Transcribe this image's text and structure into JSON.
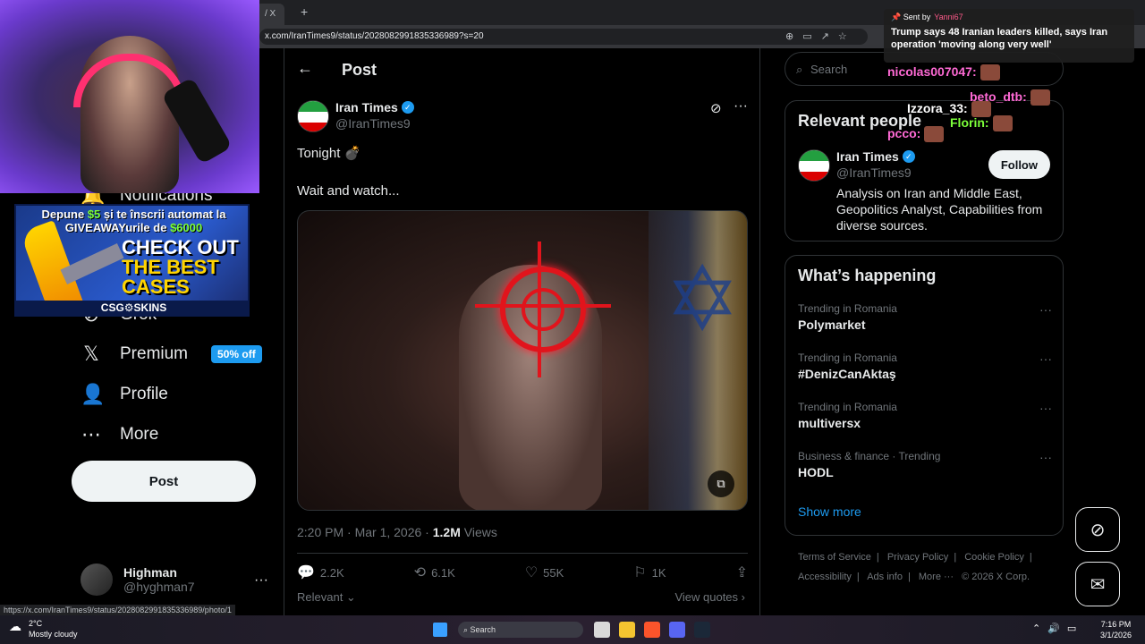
{
  "browser": {
    "tab_title": "/ X",
    "url": "x.com/IranTimes9/status/2028082991835336989?s=20",
    "status_url": "https://x.com/IranTimes9/status/2028082991835336989/photo/1"
  },
  "nav": {
    "notifications": "Notifications",
    "grok": "Grok",
    "premium": "Premium",
    "premium_badge": "50% off",
    "profile": "Profile",
    "more": "More",
    "post_button": "Post",
    "account_name": "Highman",
    "account_handle": "@hyghman7"
  },
  "post": {
    "header": "Post",
    "author_name": "Iran Times",
    "author_handle": "@IranTimes9",
    "line1": "Tonight 💣",
    "line2": "Wait and watch...",
    "timestamp": "2:20 PM · Mar 1, 2026 · ",
    "views_count": "1.2M",
    "views_label": " Views",
    "replies": "2.2K",
    "reposts": "6.1K",
    "likes": "55K",
    "bookmarks": "1K",
    "relevant": "Relevant",
    "view_quotes": "View quotes"
  },
  "right": {
    "search_placeholder": "Search",
    "relevant_people_title": "Relevant people",
    "rp_name": "Iran Times",
    "rp_handle": "@IranTimes9",
    "follow": "Follow",
    "rp_bio": "Analysis on Iran and Middle East, Geopolitics Analyst, Capabilities from diverse sources.",
    "happening_title": "What’s happening",
    "trends": [
      {
        "meta": "Trending in Romania",
        "name": "Polymarket"
      },
      {
        "meta": "Trending in Romania",
        "name": "#DenizCanAktaş"
      },
      {
        "meta": "Trending in Romania",
        "name": "multiversx"
      },
      {
        "meta": "Business & finance · Trending",
        "name": "HODL"
      }
    ],
    "show_more": "Show more",
    "footer": [
      "Terms of Service",
      "|",
      "Privacy Policy",
      "|",
      "Cookie Policy",
      "|",
      "Accessibility",
      "|",
      "Ads info",
      "|",
      "More ···",
      "© 2026 X Corp."
    ]
  },
  "overlay": {
    "notif_sent_by": "Sent by",
    "notif_user": "Yanni67",
    "notif_text": "Trump says 48 Iranian leaders killed, says Iran operation 'moving along very well'",
    "chat": [
      "nicolas007047:",
      "beto_dtb:",
      "Izzora_33:",
      "Florin:",
      "pcco:"
    ],
    "ad_top1_a": "Depune ",
    "ad_top1_b": "$5",
    "ad_top1_c": " și te înscrii automat la",
    "ad_top2_a": "GIVEAWAYurile de ",
    "ad_top2_b": "$6000",
    "ad_check": "CHECK OUT",
    "ad_best": "THE BEST",
    "ad_cases": "CASES",
    "ad_brand": "CSG⚙SKINS"
  },
  "taskbar": {
    "temp": "2°C",
    "weather": "Mostly cloudy",
    "search": "Search",
    "time": "7:16 PM",
    "date": "3/1/2026"
  },
  "colors": {
    "accent": "#1d9bf0",
    "crosshair": "#e1141c"
  }
}
